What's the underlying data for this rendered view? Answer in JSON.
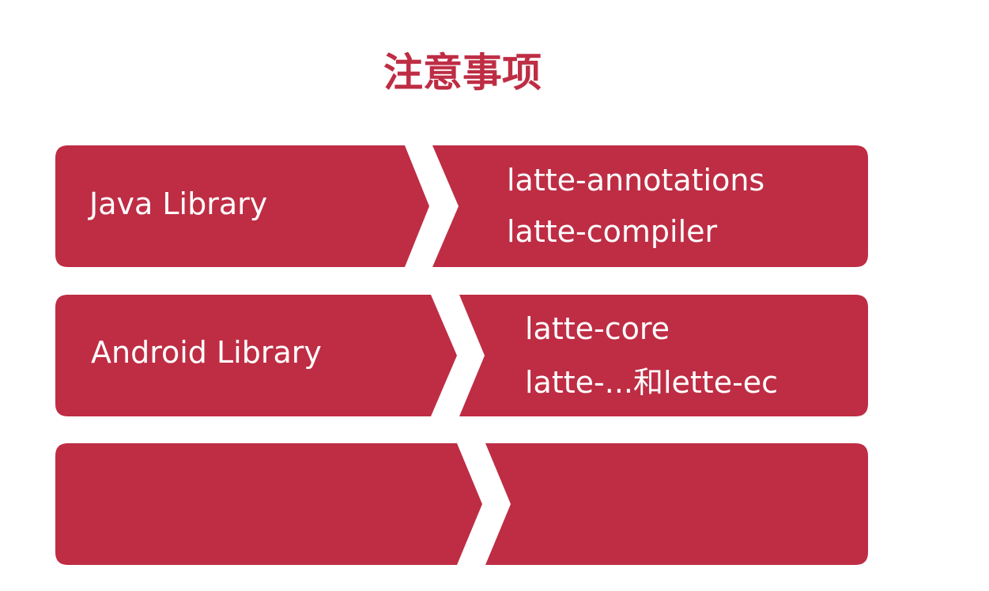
{
  "title": "注意事项",
  "colors": {
    "accent": "#BE2D44",
    "text": "#FFFFFF"
  },
  "rows": [
    {
      "label": "Java Library",
      "items": [
        "latte-annotations",
        "latte-compiler"
      ]
    },
    {
      "label": "Android Library",
      "items": [
        "latte-core",
        "latte-...和lette-ec"
      ]
    },
    {
      "label": "",
      "items": []
    }
  ]
}
